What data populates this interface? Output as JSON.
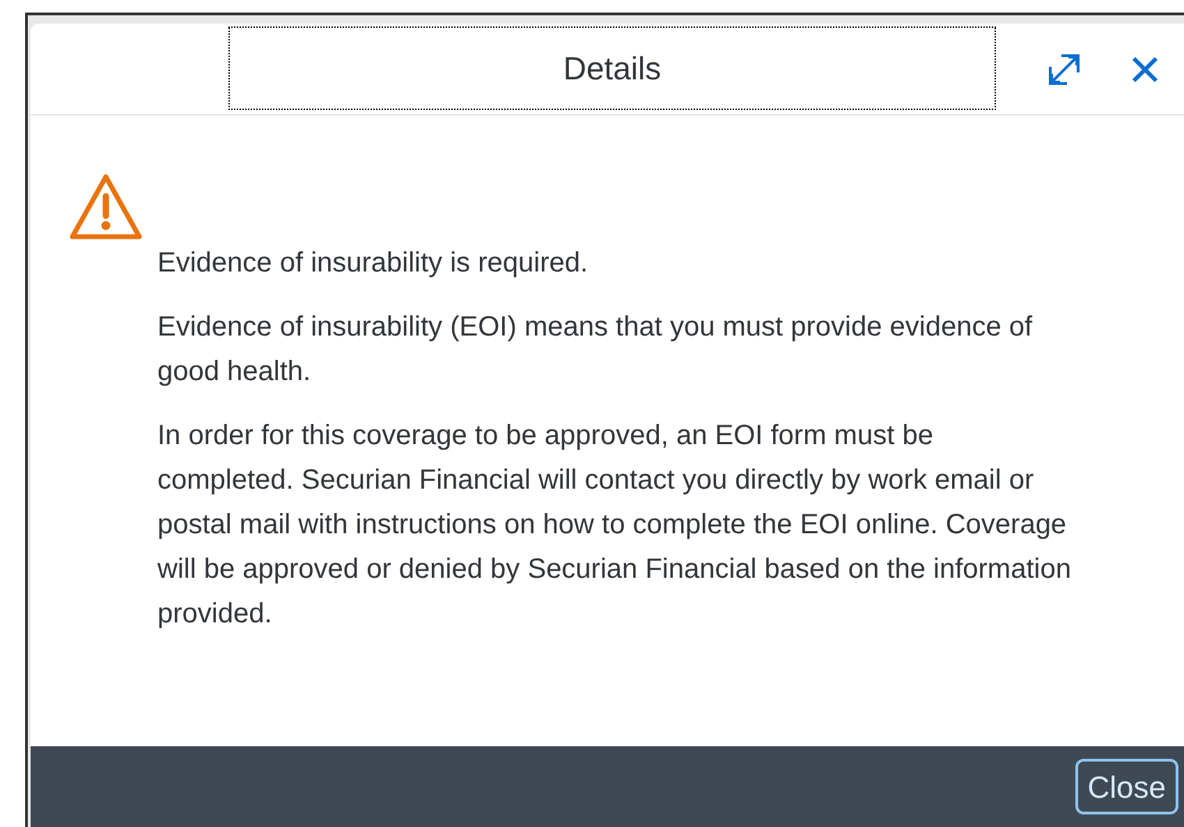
{
  "dialog": {
    "title": "Details",
    "message": {
      "heading": "Evidence of insurability is required.",
      "paragraphs": [
        "Evidence of insurability (EOI) means that you must provide evidence of good health.",
        "In order for this coverage to be approved, an EOI form must be completed. Securian Financial will contact you directly by work email or postal mail with instructions on how to complete the EOI online. Coverage will be approved or denied by Securian Financial based on the information provided."
      ]
    },
    "footer": {
      "buttons": [
        "Close"
      ]
    }
  }
}
